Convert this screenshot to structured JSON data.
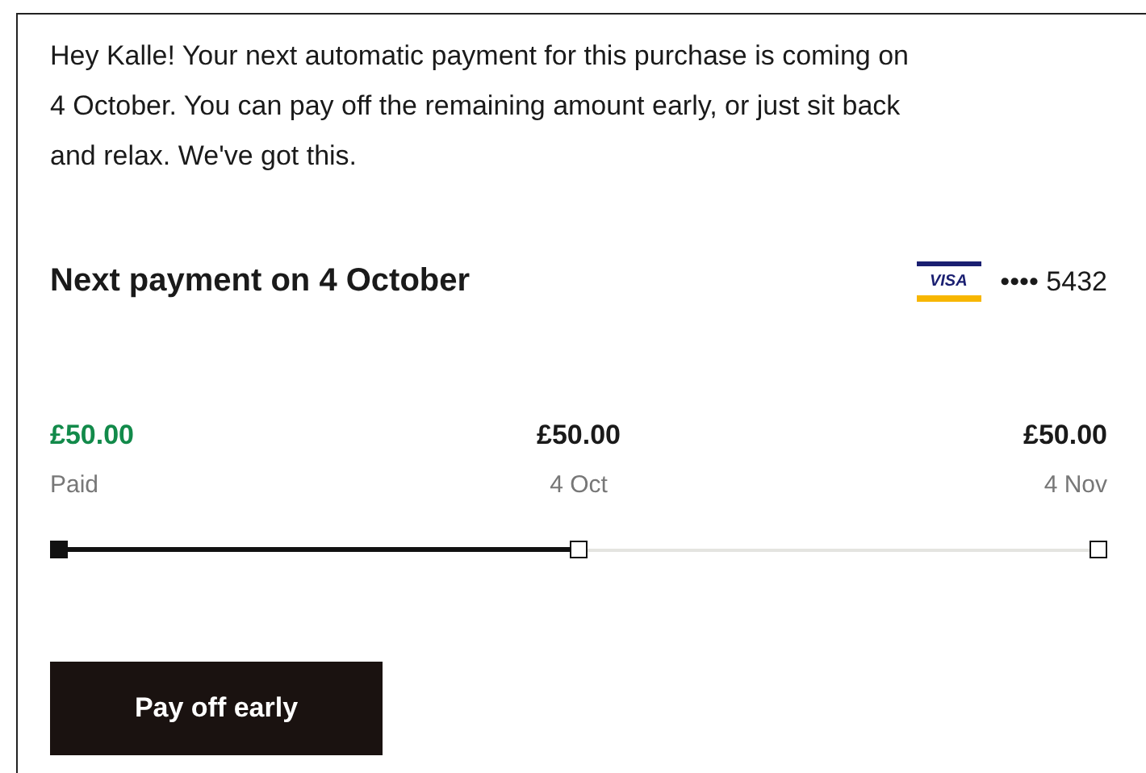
{
  "message": "Hey Kalle! Your next automatic payment for this purchase is coming on 4 October. You can pay off the remaining amount early, or just sit back and relax. We've got this.",
  "next_payment": {
    "title": "Next payment on 4 October",
    "card_brand": "VISA",
    "card_mask": "•••• 5432"
  },
  "installments": [
    {
      "amount": "£50.00",
      "label": "Paid",
      "paid": true
    },
    {
      "amount": "£50.00",
      "label": "4 Oct",
      "paid": false
    },
    {
      "amount": "£50.00",
      "label": "4 Nov",
      "paid": false
    }
  ],
  "progress": {
    "level": 0.5
  },
  "button": "Pay off early"
}
